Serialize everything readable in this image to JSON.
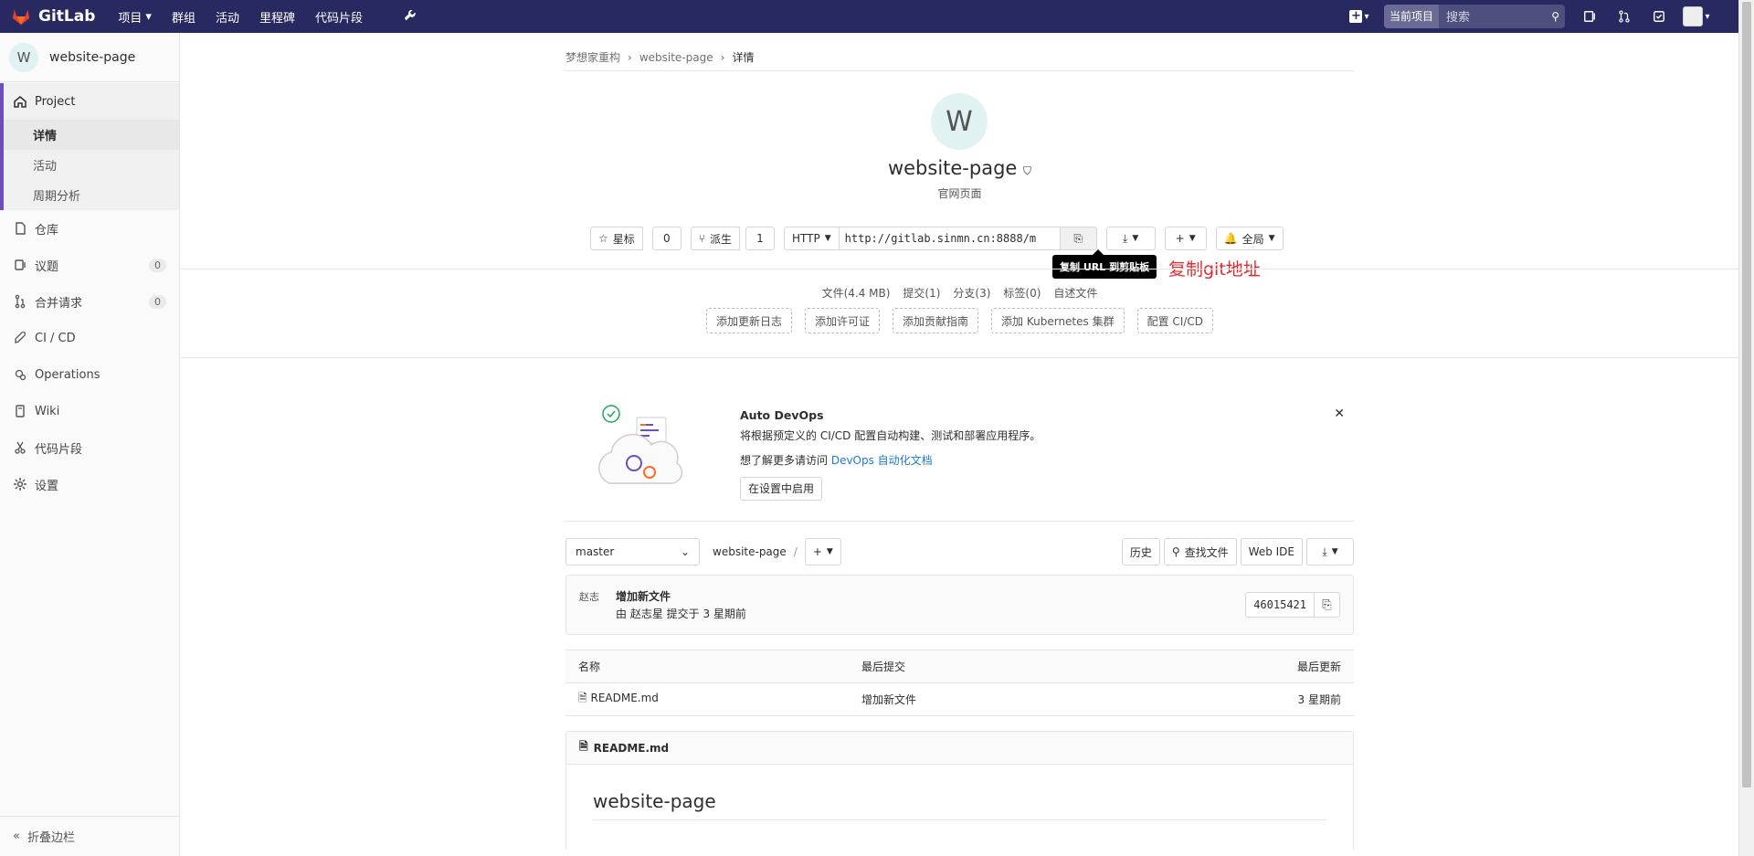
{
  "topnav": {
    "brand": "GitLab",
    "items": [
      {
        "label": "项目",
        "has_caret": true
      },
      {
        "label": "群组"
      },
      {
        "label": "活动"
      },
      {
        "label": "里程碑"
      },
      {
        "label": "代码片段"
      }
    ],
    "search_scope": "当前项目",
    "search_placeholder": "搜索"
  },
  "sidebar": {
    "project_initial": "W",
    "project_name": "website-page",
    "group_label": "Project",
    "sub_items": [
      "详情",
      "活动",
      "周期分析"
    ],
    "items": [
      {
        "label": "仓库",
        "icon": "book-icon"
      },
      {
        "label": "议题",
        "icon": "issues-icon",
        "badge": "0"
      },
      {
        "label": "合并请求",
        "icon": "merge-request-icon",
        "badge": "0"
      },
      {
        "label": "CI / CD",
        "icon": "rocket-icon"
      },
      {
        "label": "Operations",
        "icon": "cloud-gear-icon"
      },
      {
        "label": "Wiki",
        "icon": "wiki-icon"
      },
      {
        "label": "代码片段",
        "icon": "snippet-icon"
      },
      {
        "label": "设置",
        "icon": "gear-icon"
      }
    ],
    "collapse_label": "折叠边栏"
  },
  "breadcrumb": [
    "梦想家重构",
    "website-page",
    "详情"
  ],
  "project": {
    "initial": "W",
    "title": "website-page",
    "description": "官网页面"
  },
  "actions": {
    "star_label": "星标",
    "star_count": "0",
    "fork_label": "派生",
    "fork_count": "1",
    "protocol": "HTTP",
    "clone_url": "http://gitlab.sinmn.cn:8888/m",
    "notification_label": "全局"
  },
  "tooltip": "复制 URL 到剪贴板",
  "annotation": "复制git地址",
  "stats": [
    "文件(4.4 MB)",
    "提交(1)",
    "分支(3)",
    "标签(0)",
    "自述文件"
  ],
  "quick_actions": [
    "添加更新日志",
    "添加许可证",
    "添加贡献指南",
    "添加 Kubernetes 集群",
    "配置 CI/CD"
  ],
  "devops": {
    "title": "Auto DevOps",
    "line1": "将根据预定义的 CI/CD 配置自动构建、测试和部署应用程序。",
    "line2_prefix": "想了解更多请访问 ",
    "line2_link": "DevOps 自动化文档",
    "enable_button": "在设置中启用"
  },
  "tree": {
    "branch": "master",
    "path": "website-page",
    "history": "历史",
    "find_file": "查找文件",
    "web_ide": "Web IDE"
  },
  "commit": {
    "avatar_alt": "赵志",
    "message": "增加新文件",
    "by": "由 赵志星 提交于 3 星期前",
    "sha": "46015421"
  },
  "files": {
    "headers": [
      "名称",
      "最后提交",
      "最后更新"
    ],
    "rows": [
      {
        "name": "README.md",
        "commit": "增加新文件",
        "updated": "3 星期前"
      }
    ]
  },
  "readme": {
    "filename": "README.md",
    "heading": "website-page"
  }
}
